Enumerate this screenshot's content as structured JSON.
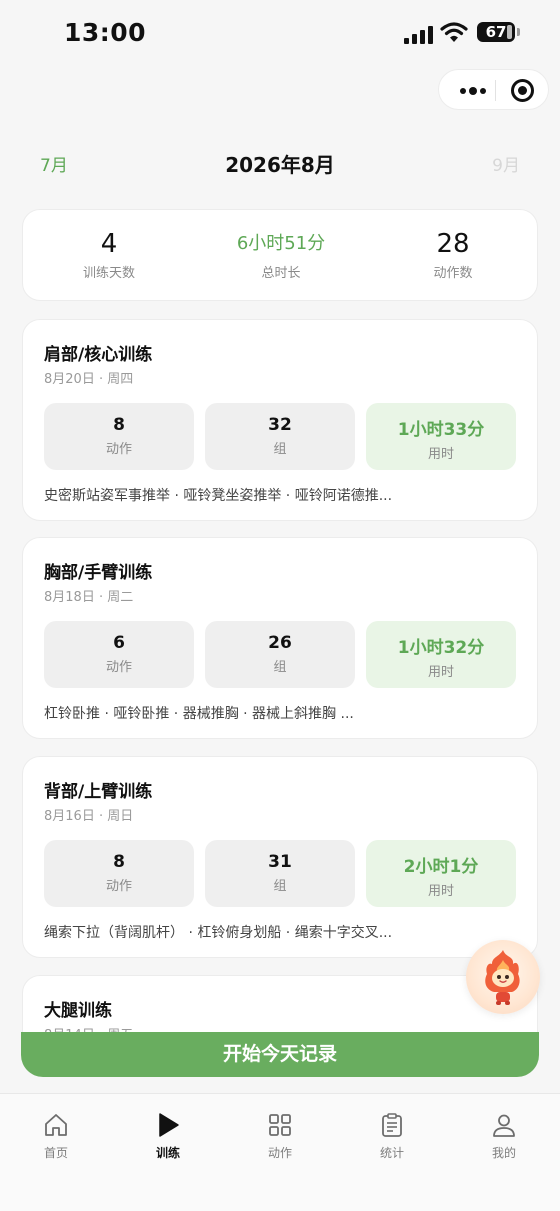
{
  "status_bar": {
    "time": "13:00",
    "battery": "67"
  },
  "month_nav": {
    "prev": "7月",
    "current": "2026年8月",
    "next": "9月"
  },
  "summary": [
    {
      "value": "4",
      "label": "训练天数"
    },
    {
      "value": "6小时51分",
      "label": "总时长"
    },
    {
      "value": "28",
      "label": "动作数"
    }
  ],
  "workouts": [
    {
      "title": "肩部/核心训练",
      "date": "8月20日 · 周四",
      "actions": "8",
      "actions_label": "动作",
      "sets": "32",
      "sets_label": "组",
      "duration": "1小时33分",
      "duration_label": "用时",
      "exercises": "史密斯站姿军事推举 · 哑铃凳坐姿推举 · 哑铃阿诺德推..."
    },
    {
      "title": "胸部/手臂训练",
      "date": "8月18日 · 周二",
      "actions": "6",
      "actions_label": "动作",
      "sets": "26",
      "sets_label": "组",
      "duration": "1小时32分",
      "duration_label": "用时",
      "exercises": "杠铃卧推 · 哑铃卧推 · 器械推胸 · 器械上斜推胸 ..."
    },
    {
      "title": "背部/上臂训练",
      "date": "8月16日 · 周日",
      "actions": "8",
      "actions_label": "动作",
      "sets": "31",
      "sets_label": "组",
      "duration": "2小时1分",
      "duration_label": "用时",
      "exercises": "绳索下拉（背阔肌杆） · 杠铃俯身划船 · 绳索十字交叉..."
    },
    {
      "title": "大腿训练",
      "date": "8月14日 · 周五"
    }
  ],
  "start_button": {
    "label": "开始今天记录"
  },
  "tabbar": [
    {
      "label": "首页",
      "icon": "home-icon",
      "active": false
    },
    {
      "label": "训练",
      "icon": "play-icon",
      "active": true
    },
    {
      "label": "动作",
      "icon": "grid-icon",
      "active": false
    },
    {
      "label": "统计",
      "icon": "clipboard-icon",
      "active": false
    },
    {
      "label": "我的",
      "icon": "person-icon",
      "active": false
    }
  ],
  "colors": {
    "accent": "#5ea856",
    "accent_light": "#e9f5e6",
    "button": "#69ad5f",
    "background": "#f6f6f6"
  }
}
